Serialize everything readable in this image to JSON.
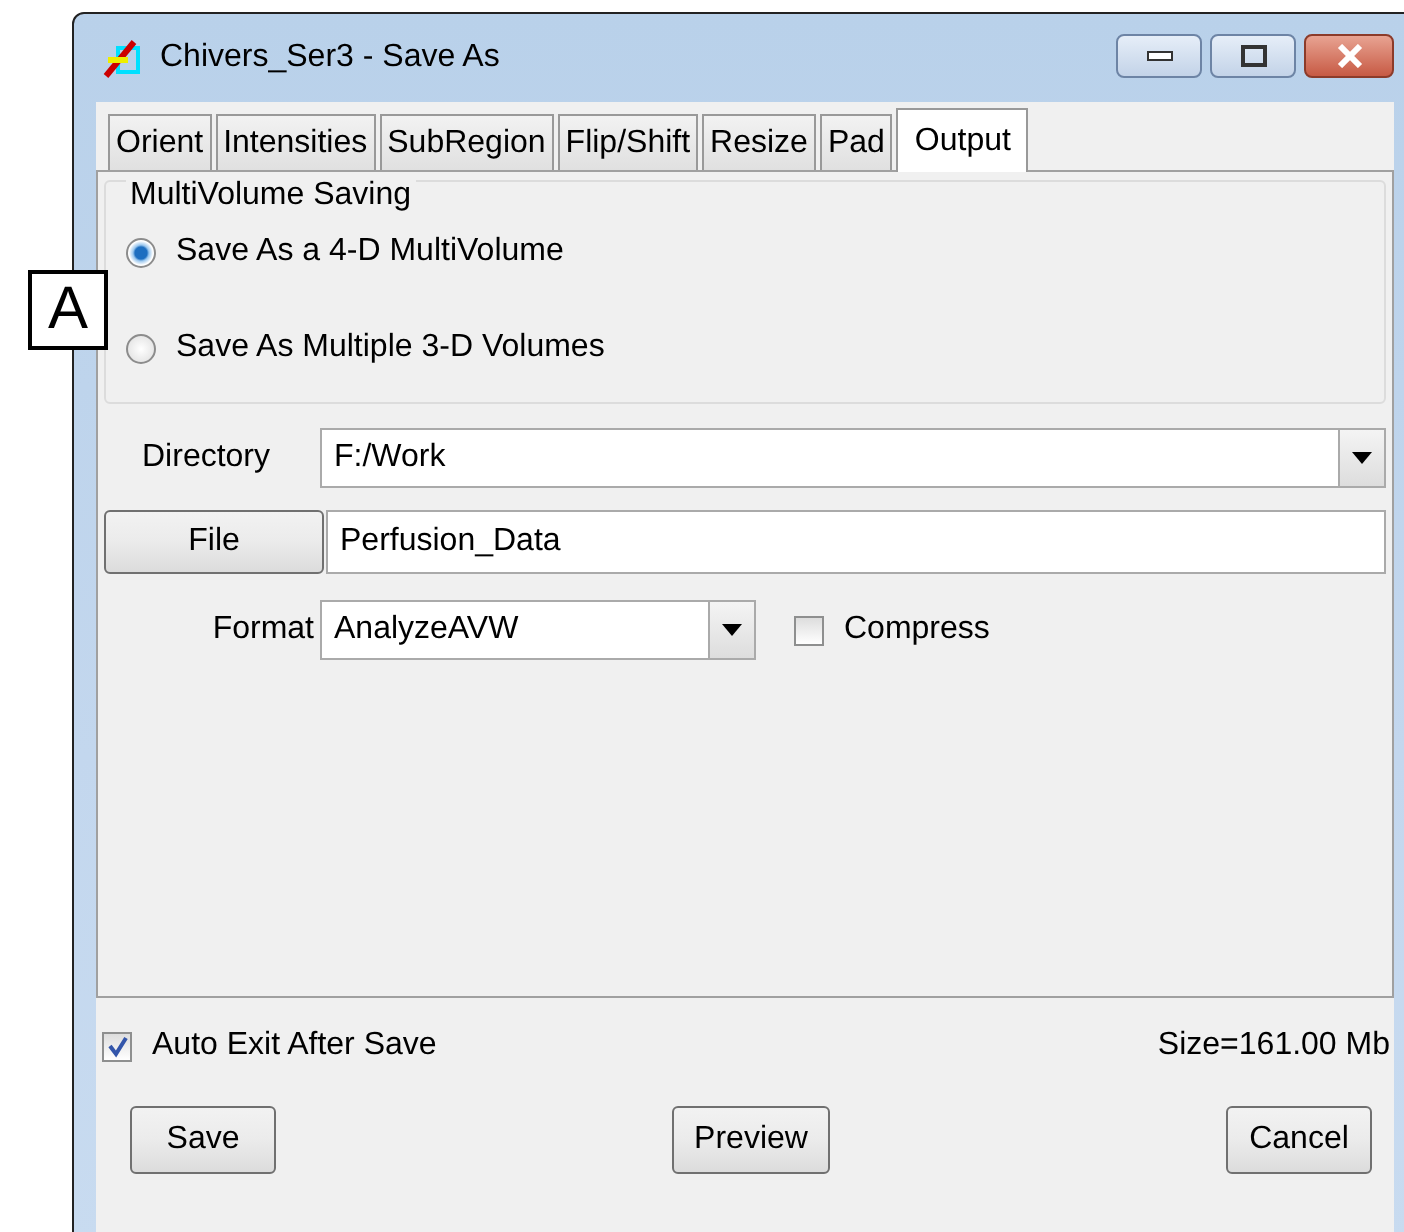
{
  "window": {
    "title": "Chivers_Ser3 - Save As"
  },
  "tabs": [
    {
      "label": "Orient",
      "selected": false
    },
    {
      "label": "Intensities",
      "selected": false
    },
    {
      "label": "SubRegion",
      "selected": false
    },
    {
      "label": "Flip/Shift",
      "selected": false
    },
    {
      "label": "Resize",
      "selected": false
    },
    {
      "label": "Pad",
      "selected": false
    },
    {
      "label": "Output",
      "selected": true
    }
  ],
  "multivolume_saving": {
    "title": "MultiVolume Saving",
    "options": [
      {
        "label": "Save As a 4-D MultiVolume",
        "selected": true
      },
      {
        "label": "Save As Multiple 3-D Volumes",
        "selected": false
      }
    ]
  },
  "directory": {
    "label": "Directory",
    "value": "F:/Work"
  },
  "file": {
    "button": "File",
    "value": "Perfusion_Data"
  },
  "format": {
    "label": "Format",
    "value": "AnalyzeAVW"
  },
  "compress": {
    "label": "Compress",
    "checked": false
  },
  "auto_exit": {
    "label": "Auto Exit After Save",
    "checked": true
  },
  "size": "Size=161.00 Mb",
  "buttons": [
    "Save",
    "Preview",
    "Cancel"
  ],
  "callout": "A"
}
